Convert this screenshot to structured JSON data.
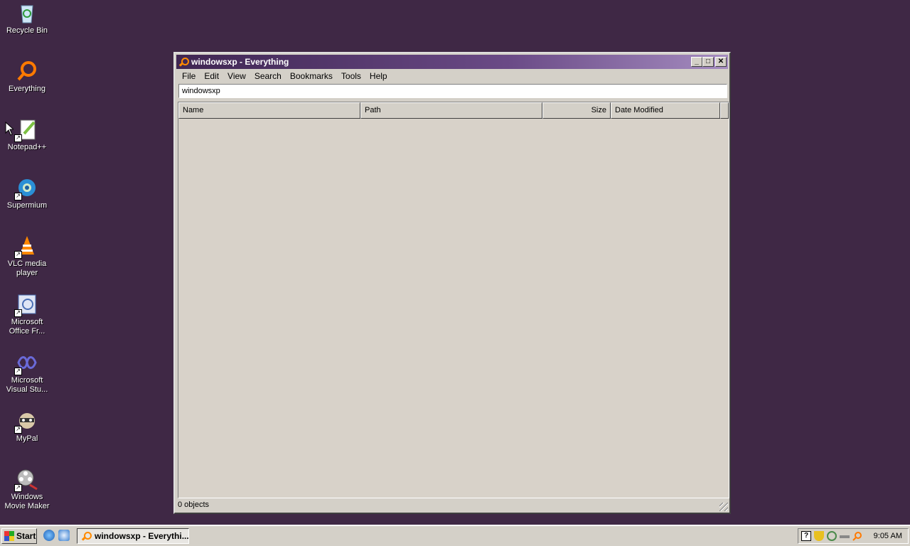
{
  "desktop": {
    "icons": [
      {
        "label": "Recycle Bin",
        "icon": "recycle-bin-icon",
        "color": "#9ac4ee"
      },
      {
        "label": "Everything",
        "icon": "everything-icon",
        "color": "#ff7a00"
      },
      {
        "label": "Notepad++",
        "icon": "notepadpp-icon",
        "color": "#7cc043"
      },
      {
        "label": "Supermium",
        "icon": "supermium-icon",
        "color": "#2a8fd6"
      },
      {
        "label": "VLC media player",
        "icon": "vlc-icon",
        "color": "#ff8800"
      },
      {
        "label": "Microsoft Office Fr...",
        "icon": "office-frontpage-icon",
        "color": "#4a6fb5"
      },
      {
        "label": "Microsoft Visual Stu...",
        "icon": "visual-studio-icon",
        "color": "#5c2d91"
      },
      {
        "label": "MyPal",
        "icon": "mypal-icon",
        "color": "#7a5a3a"
      },
      {
        "label": "Windows Movie Maker",
        "icon": "movie-maker-icon",
        "color": "#888888"
      }
    ]
  },
  "window": {
    "title": "windowsxp - Everything",
    "menu": [
      "File",
      "Edit",
      "View",
      "Search",
      "Bookmarks",
      "Tools",
      "Help"
    ],
    "search_value": "windowsxp",
    "columns": [
      "Name",
      "Path",
      "Size",
      "Date Modified"
    ],
    "status": "0 objects",
    "titlebar_colors": [
      "#3f2652",
      "#a58cc0"
    ]
  },
  "taskbar": {
    "start_label": "Start",
    "task_label": "windowsxp - Everythi...",
    "clock": "9:05 AM"
  },
  "colors": {
    "desktop_bg": "#3f2845",
    "window_bg": "#d4d0c8"
  }
}
